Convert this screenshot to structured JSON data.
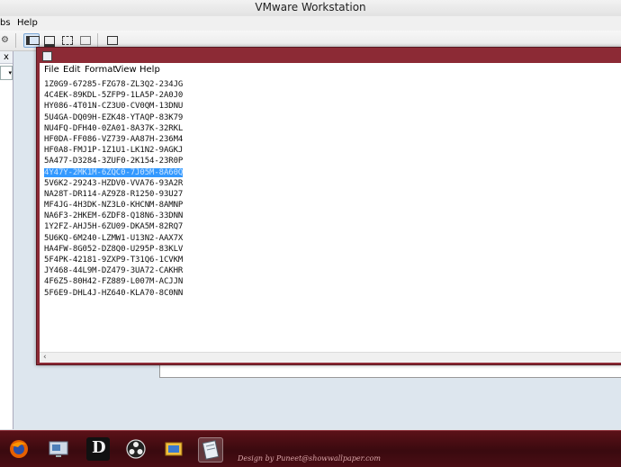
{
  "vmware": {
    "title": "VMware Workstation",
    "menu": {
      "tabs_partial": "bs",
      "help": "Help"
    },
    "left_header_partial": "x",
    "left_combo_arrow": "▾"
  },
  "notepad": {
    "menu": [
      "File",
      "Edit",
      "Format",
      "View",
      "Help"
    ],
    "lines": [
      "1Z0G9-67285-FZG78-ZL3Q2-234JG",
      "4C4EK-89KDL-5ZFP9-1LA5P-2A0J0",
      "HY086-4T01N-CZ3U0-CV0QM-13DNU",
      "5U4GA-DQ09H-EZK48-YTAQP-83K79",
      "NU4FQ-DFH40-0ZA01-8A37K-32RKL",
      "HF0DA-FF086-VZ739-AA87H-236M4",
      "HF0A8-FMJ1P-1Z1U1-LK1N2-9AGKJ",
      "5A477-D3284-3ZUF0-2K154-23R0P",
      "4Y47Y-2MK1M-6ZQC0-7J05M-8A60Q",
      "5V6K2-29243-HZDV0-VVA76-93A2R",
      "NA28T-DR114-AZ9Z8-R1250-93U27",
      "MF4JG-4H3DK-NZ3L0-KHCNM-8AMNP",
      "NA6F3-2HKEM-6ZDF8-Q18N6-33DNN",
      "1Y2FZ-AHJ5H-6ZU09-DKA5M-82RQ7",
      "5U6KQ-6M240-LZMW1-U13N2-AAX7X",
      "HA4FW-8G052-DZ8Q0-U295P-83KLV",
      "5F4PK-42181-9ZXP9-T31Q6-1CVKM",
      "JY468-44L9M-DZ479-3UA72-CAKHR",
      "4F6Z5-80H42-FZ889-L007M-ACJJN",
      "5F6E9-DHL4J-HZ640-KLA70-8C0NN"
    ],
    "selected_line_index": 8,
    "scroll_left_arrow": "‹"
  },
  "taskbar": {
    "credit": "Design by Puneet@showwallpaper.com",
    "apps": [
      "firefox-icon",
      "remote-desktop-icon",
      "d-app-icon",
      "obs-icon",
      "file-explorer-icon",
      "notepad-icon"
    ],
    "active_app": "notepad-icon",
    "d_app_label": "D"
  },
  "colors": {
    "notepad_frame": "#8c2a35",
    "selection": "#3399ff",
    "taskbar": "#4a0d14"
  }
}
